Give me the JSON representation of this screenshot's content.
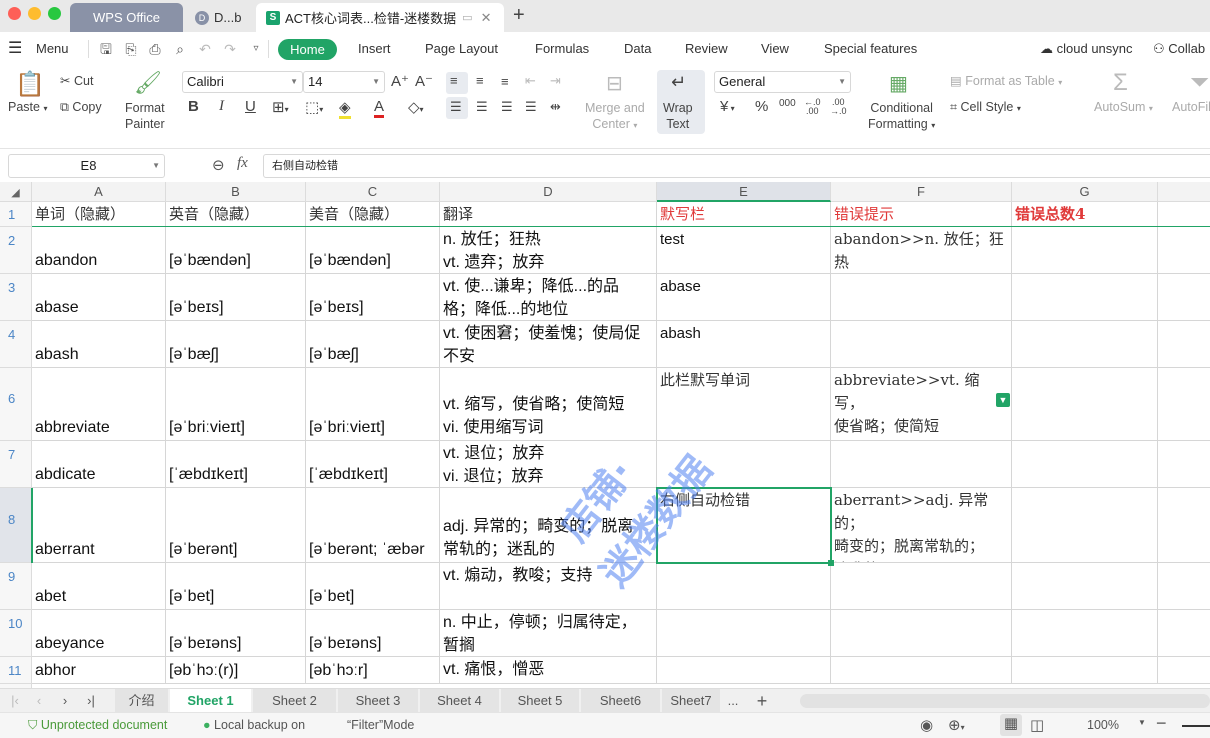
{
  "titlebar": {
    "tabs": [
      {
        "label": "WPS Office"
      },
      {
        "label": "D...b",
        "badge": "D"
      },
      {
        "label": "ACT核心词表...检错-迷楼数据",
        "badge": "S"
      }
    ],
    "new_tab": "+",
    "close": "✕"
  },
  "menubar": {
    "menu_label": "Menu",
    "tabs": [
      "Home",
      "Insert",
      "Page Layout",
      "Formulas",
      "Data",
      "Review",
      "View",
      "Special features"
    ],
    "active_tab": "Home",
    "cloud": "cloud unsync",
    "collab": "Collab"
  },
  "ribbon": {
    "paste": "Paste",
    "cut": "Cut",
    "copy": "Copy",
    "format_painter": [
      "Format",
      "Painter"
    ],
    "font_name": "Calibri",
    "font_size": "14",
    "merge_center": [
      "Merge and",
      "Center"
    ],
    "wrap_text": [
      "Wrap",
      "Text"
    ],
    "number_format": "General",
    "conditional_formatting": [
      "Conditional",
      "Formatting"
    ],
    "format_as_table": "Format as Table",
    "cell_style": "Cell Style",
    "autosum": "AutoSum",
    "autofilter": "AutoFil",
    "currency_symbol": "¥"
  },
  "formula_bar": {
    "name_box": "E8",
    "fx": "fx",
    "content": "右侧自动检错"
  },
  "grid": {
    "columns": [
      "A",
      "B",
      "C",
      "D",
      "E",
      "F",
      "G"
    ],
    "header_row": {
      "row": "1",
      "cells": [
        "单词（隐藏）",
        "英音（隐藏）",
        "美音（隐藏）",
        "翻译",
        "默写栏",
        "错误提示",
        "错误总数4"
      ]
    },
    "rows": [
      {
        "row": "2",
        "word": "abandon",
        "uk": "[əˈbændən]",
        "us": "[əˈbændən]",
        "trans": "n. 放任；狂热\nvt. 遗弃；放弃",
        "dictation": "test",
        "hint": "abandon>>n. 放任；狂\n热"
      },
      {
        "row": "3",
        "word": "abase",
        "uk": "[əˈbeɪs]",
        "us": "[əˈbeɪs]",
        "trans": "vt. 使...谦卑；降低...的品\n格；降低...的地位",
        "dictation": "abase",
        "hint": ""
      },
      {
        "row": "4",
        "word": "abash",
        "uk": "[əˈbæʃ]",
        "us": "[əˈbæʃ]",
        "trans": "vt. 使困窘；使羞愧；使局促\n不安",
        "dictation": "abash",
        "hint": ""
      },
      {
        "row": "6",
        "word": "abbreviate",
        "uk": "[əˈbriːvieɪt]",
        "us": "[əˈbriːvieɪt]",
        "trans": "vt. 缩写，使省略；使简短\nvi. 使用缩写词",
        "dictation": "此栏默写单词",
        "hint": "abbreviate>>vt. 缩写，\n使省略；使简短\nvi. 使用缩写词"
      },
      {
        "row": "7",
        "word": "abdicate",
        "uk": "[ˈæbdɪkeɪt]",
        "us": "[ˈæbdɪkeɪt]",
        "trans": "vt. 退位；放弃\nvi. 退位；放弃",
        "dictation": "",
        "hint": ""
      },
      {
        "row": "8",
        "word": "aberrant",
        "uk": "[əˈberənt]",
        "us": "[əˈberənt; ˈæbər",
        "trans": "adj. 异常的；畸变的；脱离\n常轨的；迷乱的",
        "dictation": "右侧自动检错",
        "hint": "aberrant>>adj. 异常的；\n畸变的；脱离常轨的；\n迷乱的"
      },
      {
        "row": "9",
        "word": "abet",
        "uk": "[əˈbet]",
        "us": "[əˈbet]",
        "trans": "vt. 煽动，教唆；支持",
        "dictation": "",
        "hint": ""
      },
      {
        "row": "10",
        "word": "abeyance",
        "uk": "[əˈbeɪəns]",
        "us": "[əˈbeɪəns]",
        "trans": "n. 中止，停顿；归属待定，\n暂搁",
        "dictation": "",
        "hint": ""
      },
      {
        "row": "11",
        "word": "abhor",
        "uk": "[əbˈhɔː(r)]",
        "us": "[əbˈhɔːr]",
        "trans": "vt. 痛恨，憎恶",
        "dictation": "",
        "hint": ""
      }
    ],
    "selected_cell": "E8",
    "watermark": [
      "店铺·",
      "迷楼数据"
    ]
  },
  "sheet_tabs": {
    "tabs": [
      "介绍",
      "Sheet 1",
      "Sheet 2",
      "Sheet 3",
      "Sheet 4",
      "Sheet 5",
      "Sheet6",
      "Sheet7"
    ],
    "active": "Sheet 1",
    "more": "...",
    "add": "+"
  },
  "status": {
    "protection": "Unprotected document",
    "backup": "Local backup on",
    "mode": "“Filter”Mode",
    "zoom": "100%"
  },
  "colors": {
    "accent": "#21a466",
    "header_red": "#e03a3a",
    "row_number": "#4c86c6",
    "watermark": "#5082f0"
  }
}
